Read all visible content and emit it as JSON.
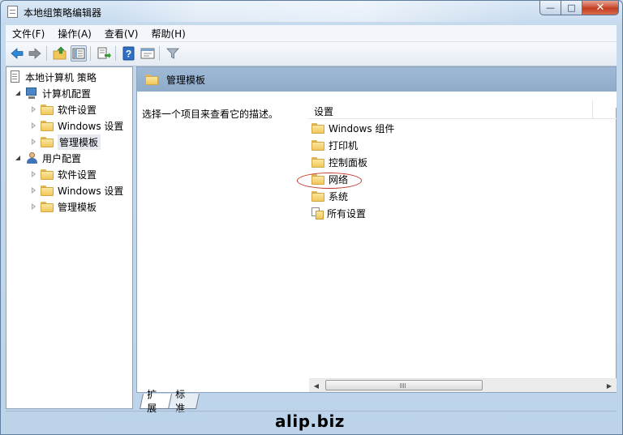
{
  "window": {
    "title": "本地组策略编辑器",
    "controls": {
      "minimize": "—",
      "maximize": "□",
      "close": "✕"
    }
  },
  "menu": [
    {
      "label": "文件(F)"
    },
    {
      "label": "操作(A)"
    },
    {
      "label": "查看(V)"
    },
    {
      "label": "帮助(H)"
    }
  ],
  "toolbar": {
    "buttons": [
      "back-arrow-icon",
      "forward-arrow-icon",
      "up-folder-icon",
      "show-hide-tree-icon",
      "export-list-icon",
      "help-icon",
      "properties-icon",
      "filter-icon"
    ]
  },
  "tree": {
    "root": "本地计算机 策略",
    "computer_config": "计算机配置",
    "user_config": "用户配置",
    "software_settings": "软件设置",
    "windows_settings": "Windows 设置",
    "admin_templates": "管理模板"
  },
  "right": {
    "header_title": "管理模板",
    "description": "选择一个项目来查看它的描述。",
    "column_header": "设置",
    "items": [
      {
        "label": "Windows 组件"
      },
      {
        "label": "打印机"
      },
      {
        "label": "控制面板"
      },
      {
        "label": "网络"
      },
      {
        "label": "系统"
      },
      {
        "label": "所有设置"
      }
    ]
  },
  "tabs": {
    "extended": "扩展",
    "standard": "标准"
  },
  "watermark": "alip.biz",
  "colors": {
    "window_frame": "#c9dcef",
    "header_blue": "#9fbad6",
    "highlight_circle": "#c0392b"
  }
}
